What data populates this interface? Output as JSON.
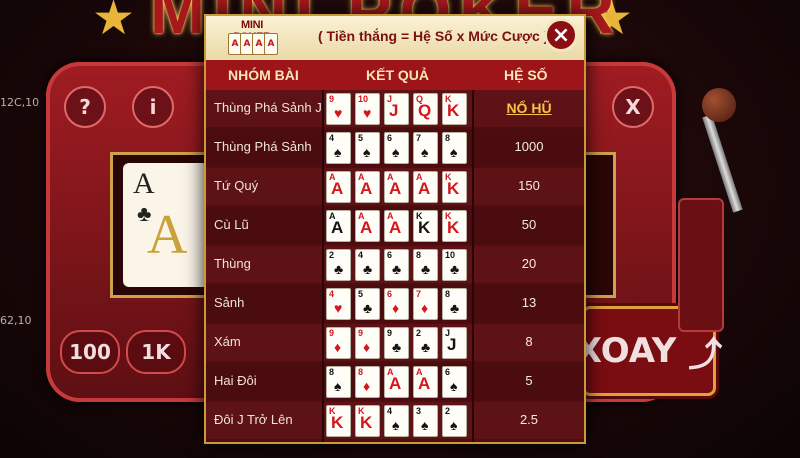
{
  "background": {
    "title": "MINI POKER",
    "buttons": [
      "?",
      "i",
      "X"
    ],
    "chips": [
      "100",
      "1K"
    ],
    "spin_label": "XOAY",
    "reel_cards": [
      {
        "rank": "A",
        "suit": "♣"
      }
    ],
    "side_text": [
      "12C,10",
      "62,10"
    ]
  },
  "modal": {
    "logo_text": "MINI POKER",
    "logo_cards": [
      "A",
      "A",
      "A",
      "A"
    ],
    "formula": "( Tiền thắng = Hệ Số x Mức Cược )",
    "close_icon": "×",
    "headers": {
      "hand": "NHÓM BÀI",
      "result": "KẾT QUẢ",
      "multiplier": "HỆ SỐ"
    },
    "rows": [
      {
        "hand": "Thùng Phá Sảnh J",
        "multiplier": "NỔ HŨ",
        "jackpot": true,
        "cards": [
          {
            "r": "9",
            "s": "♥",
            "c": "red"
          },
          {
            "r": "10",
            "s": "♥",
            "c": "red"
          },
          {
            "r": "J",
            "s": "J",
            "c": "red",
            "f": 1
          },
          {
            "r": "Q",
            "s": "Q",
            "c": "red",
            "f": 1
          },
          {
            "r": "K",
            "s": "K",
            "c": "red",
            "f": 1
          }
        ]
      },
      {
        "hand": "Thùng Phá Sảnh",
        "multiplier": "1000",
        "cards": [
          {
            "r": "4",
            "s": "♠",
            "c": "blk"
          },
          {
            "r": "5",
            "s": "♠",
            "c": "blk"
          },
          {
            "r": "6",
            "s": "♠",
            "c": "blk"
          },
          {
            "r": "7",
            "s": "♠",
            "c": "blk"
          },
          {
            "r": "8",
            "s": "♠",
            "c": "blk"
          }
        ]
      },
      {
        "hand": "Tứ Quý",
        "multiplier": "150",
        "cards": [
          {
            "r": "A",
            "s": "A",
            "c": "red",
            "f": 1
          },
          {
            "r": "A",
            "s": "A",
            "c": "red",
            "f": 1
          },
          {
            "r": "A",
            "s": "A",
            "c": "red",
            "f": 1
          },
          {
            "r": "A",
            "s": "A",
            "c": "red",
            "f": 1
          },
          {
            "r": "K",
            "s": "K",
            "c": "red",
            "f": 1
          }
        ]
      },
      {
        "hand": "Cù Lũ",
        "multiplier": "50",
        "cards": [
          {
            "r": "A",
            "s": "A",
            "c": "blk",
            "f": 1
          },
          {
            "r": "A",
            "s": "A",
            "c": "red",
            "f": 1
          },
          {
            "r": "A",
            "s": "A",
            "c": "red",
            "f": 1
          },
          {
            "r": "K",
            "s": "K",
            "c": "blk",
            "f": 1
          },
          {
            "r": "K",
            "s": "K",
            "c": "red",
            "f": 1
          }
        ]
      },
      {
        "hand": "Thùng",
        "multiplier": "20",
        "cards": [
          {
            "r": "2",
            "s": "♣",
            "c": "blk"
          },
          {
            "r": "4",
            "s": "♣",
            "c": "blk"
          },
          {
            "r": "6",
            "s": "♣",
            "c": "blk"
          },
          {
            "r": "8",
            "s": "♣",
            "c": "blk"
          },
          {
            "r": "10",
            "s": "♣",
            "c": "blk"
          }
        ]
      },
      {
        "hand": "Sảnh",
        "multiplier": "13",
        "cards": [
          {
            "r": "4",
            "s": "♥",
            "c": "red"
          },
          {
            "r": "5",
            "s": "♣",
            "c": "blk"
          },
          {
            "r": "6",
            "s": "♦",
            "c": "red"
          },
          {
            "r": "7",
            "s": "♦",
            "c": "red"
          },
          {
            "r": "8",
            "s": "♣",
            "c": "blk"
          }
        ]
      },
      {
        "hand": "Xám",
        "multiplier": "8",
        "cards": [
          {
            "r": "9",
            "s": "♦",
            "c": "red"
          },
          {
            "r": "9",
            "s": "♦",
            "c": "red"
          },
          {
            "r": "9",
            "s": "♣",
            "c": "blk"
          },
          {
            "r": "2",
            "s": "♣",
            "c": "blk"
          },
          {
            "r": "J",
            "s": "J",
            "c": "blk",
            "f": 1
          }
        ]
      },
      {
        "hand": "Hai Đôi",
        "multiplier": "5",
        "cards": [
          {
            "r": "8",
            "s": "♠",
            "c": "blk"
          },
          {
            "r": "8",
            "s": "♦",
            "c": "red"
          },
          {
            "r": "A",
            "s": "A",
            "c": "red",
            "f": 1
          },
          {
            "r": "A",
            "s": "A",
            "c": "red",
            "f": 1
          },
          {
            "r": "6",
            "s": "♠",
            "c": "blk"
          }
        ]
      },
      {
        "hand": "Đôi J Trở Lên",
        "multiplier": "2.5",
        "cards": [
          {
            "r": "K",
            "s": "K",
            "c": "red",
            "f": 1
          },
          {
            "r": "K",
            "s": "K",
            "c": "red",
            "f": 1
          },
          {
            "r": "4",
            "s": "♠",
            "c": "blk"
          },
          {
            "r": "3",
            "s": "♠",
            "c": "blk"
          },
          {
            "r": "2",
            "s": "♠",
            "c": "blk"
          }
        ]
      }
    ]
  },
  "colors": {
    "accent": "#c89a3a",
    "header": "#9d1419",
    "jackpot": "#f6c34a"
  }
}
